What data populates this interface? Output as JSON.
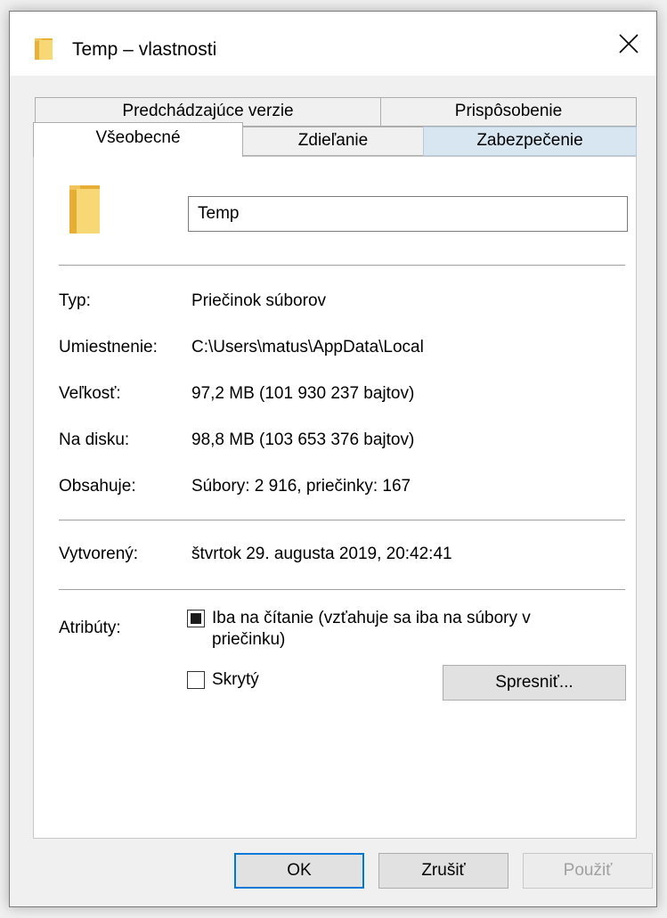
{
  "window": {
    "title": "Temp – vlastnosti"
  },
  "tabs": {
    "row1": [
      {
        "label": "Predchádzajúce verzie"
      },
      {
        "label": "Prispôsobenie"
      }
    ],
    "row2": [
      {
        "label": "Všeobecné",
        "active": true
      },
      {
        "label": "Zdieľanie"
      },
      {
        "label": "Zabezpečenie"
      }
    ]
  },
  "general": {
    "name_value": "Temp",
    "type_label": "Typ:",
    "type_value": "Priečinok súborov",
    "location_label": "Umiestnenie:",
    "location_value": "C:\\Users\\matus\\AppData\\Local",
    "size_label": "Veľkosť:",
    "size_value": "97,2 MB (101 930 237 bajtov)",
    "disk_label": "Na disku:",
    "disk_value": "98,8 MB (103 653 376 bajtov)",
    "contains_label": "Obsahuje:",
    "contains_value": "Súbory: 2 916, priečinky: 167",
    "created_label": "Vytvorený:",
    "created_value": "štvrtok 29. augusta 2019, 20:42:41",
    "attributes_label": "Atribúty:",
    "readonly_label": "Iba na čítanie (vzťahuje sa iba na súbory v priečinku)",
    "readonly_state": "indeterminate",
    "hidden_label": "Skrytý",
    "hidden_checked": false,
    "advanced_button": "Spresniť..."
  },
  "buttons": {
    "ok": "OK",
    "cancel": "Zrušiť",
    "apply": "Použiť"
  },
  "colors": {
    "accent": "#0078d7",
    "tab_hover": "#d8e6f2",
    "folder": "#f8d775"
  },
  "icons": {
    "title": "folder-icon",
    "close": "close-icon",
    "large": "folder-icon"
  }
}
